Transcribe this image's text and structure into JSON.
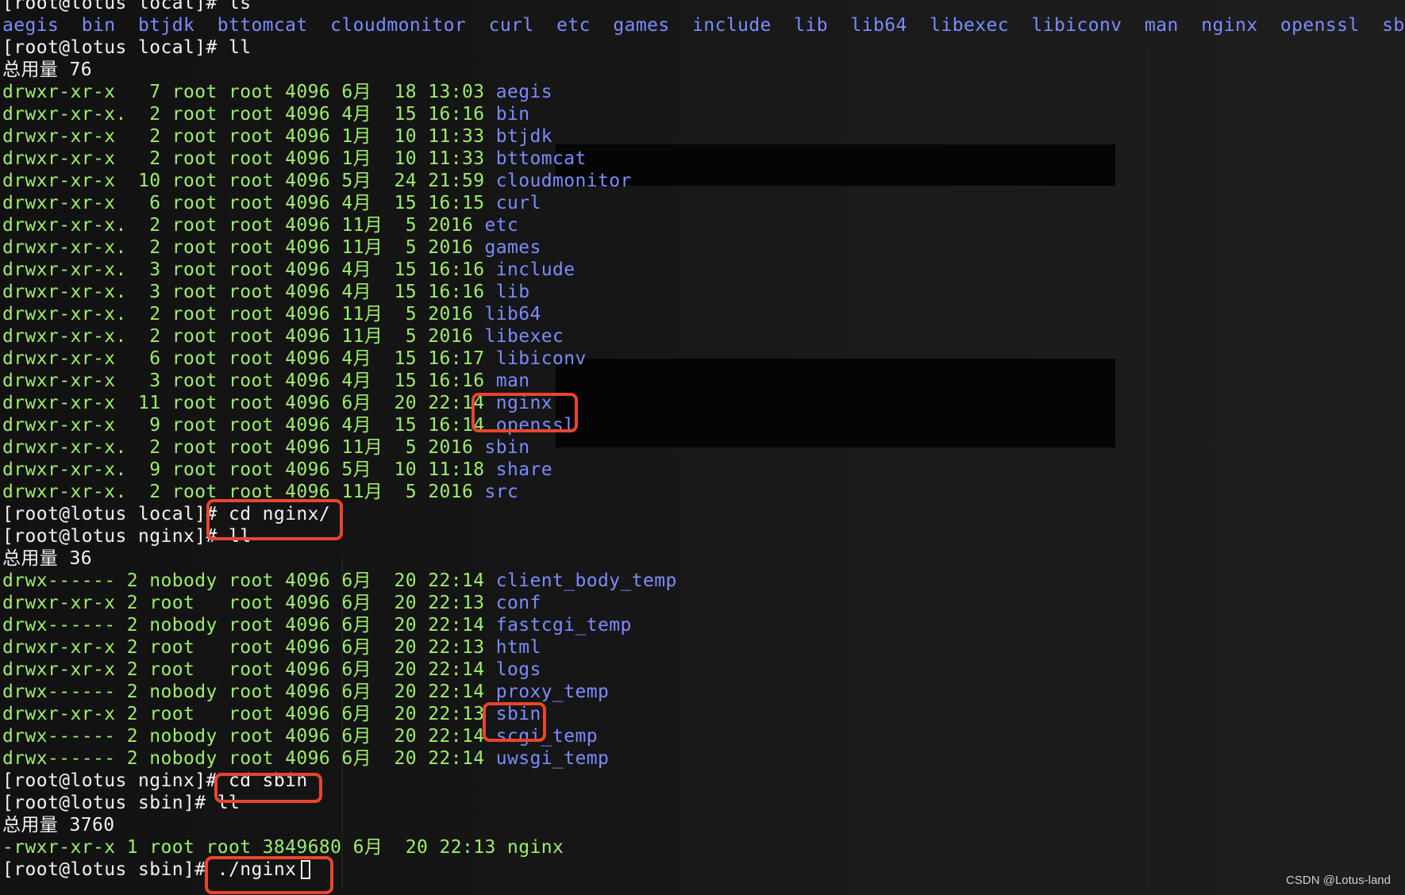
{
  "terminal": {
    "colors": {
      "prompt": "#f2f2f2",
      "listing": "#9dee6c",
      "directory": "#7c8cff",
      "highlight": "#e8452e",
      "background": "#141414"
    },
    "lines": [
      [
        {
          "t": "[root@lotus local]# ls",
          "c": "white"
        }
      ],
      [
        {
          "t": "aegis  bin  btjdk  bttomcat  cloudmonitor  curl  etc  games  include  lib  lib64  libexec  libiconv  man  nginx  openssl  sbin",
          "c": "blue"
        }
      ],
      [
        {
          "t": "[root@lotus local]# ll",
          "c": "white"
        }
      ],
      [
        {
          "t": "总用量 76",
          "c": "white"
        }
      ],
      [
        {
          "t": "drwxr-xr-x   7 root root 4096 6月  18 13:03 ",
          "c": "green"
        },
        {
          "t": "aegis",
          "c": "blue"
        }
      ],
      [
        {
          "t": "drwxr-xr-x.  2 root root 4096 4月  15 16:16 ",
          "c": "green"
        },
        {
          "t": "bin",
          "c": "blue"
        }
      ],
      [
        {
          "t": "drwxr-xr-x   2 root root 4096 1月  10 11:33 ",
          "c": "green"
        },
        {
          "t": "btjdk",
          "c": "blue"
        }
      ],
      [
        {
          "t": "drwxr-xr-x   2 root root 4096 1月  10 11:33 ",
          "c": "green"
        },
        {
          "t": "bttomcat",
          "c": "blue"
        }
      ],
      [
        {
          "t": "drwxr-xr-x  10 root root 4096 5月  24 21:59 ",
          "c": "green"
        },
        {
          "t": "cloudmonitor",
          "c": "blue"
        }
      ],
      [
        {
          "t": "drwxr-xr-x   6 root root 4096 4月  15 16:15 ",
          "c": "green"
        },
        {
          "t": "curl",
          "c": "blue"
        }
      ],
      [
        {
          "t": "drwxr-xr-x.  2 root root 4096 11月  5 2016 ",
          "c": "green"
        },
        {
          "t": "etc",
          "c": "blue"
        }
      ],
      [
        {
          "t": "drwxr-xr-x.  2 root root 4096 11月  5 2016 ",
          "c": "green"
        },
        {
          "t": "games",
          "c": "blue"
        }
      ],
      [
        {
          "t": "drwxr-xr-x.  3 root root 4096 4月  15 16:16 ",
          "c": "green"
        },
        {
          "t": "include",
          "c": "blue"
        }
      ],
      [
        {
          "t": "drwxr-xr-x.  3 root root 4096 4月  15 16:16 ",
          "c": "green"
        },
        {
          "t": "lib",
          "c": "blue"
        }
      ],
      [
        {
          "t": "drwxr-xr-x.  2 root root 4096 11月  5 2016 ",
          "c": "green"
        },
        {
          "t": "lib64",
          "c": "blue"
        }
      ],
      [
        {
          "t": "drwxr-xr-x.  2 root root 4096 11月  5 2016 ",
          "c": "green"
        },
        {
          "t": "libexec",
          "c": "blue"
        }
      ],
      [
        {
          "t": "drwxr-xr-x   6 root root 4096 4月  15 16:17 ",
          "c": "green"
        },
        {
          "t": "libiconv",
          "c": "blue"
        }
      ],
      [
        {
          "t": "drwxr-xr-x   3 root root 4096 4月  15 16:16 ",
          "c": "green"
        },
        {
          "t": "man",
          "c": "blue"
        }
      ],
      [
        {
          "t": "drwxr-xr-x  11 root root 4096 6月  20 22:14 ",
          "c": "green"
        },
        {
          "t": "nginx",
          "c": "blue"
        }
      ],
      [
        {
          "t": "drwxr-xr-x   9 root root 4096 4月  15 16:14 ",
          "c": "green"
        },
        {
          "t": "openssl",
          "c": "blue"
        }
      ],
      [
        {
          "t": "drwxr-xr-x.  2 root root 4096 11月  5 2016 ",
          "c": "green"
        },
        {
          "t": "sbin",
          "c": "blue"
        }
      ],
      [
        {
          "t": "drwxr-xr-x.  9 root root 4096 5月  10 11:18 ",
          "c": "green"
        },
        {
          "t": "share",
          "c": "blue"
        }
      ],
      [
        {
          "t": "drwxr-xr-x.  2 root root 4096 11月  5 2016 ",
          "c": "green"
        },
        {
          "t": "src",
          "c": "blue"
        }
      ],
      [
        {
          "t": "[root@lotus local]# cd nginx/",
          "c": "white"
        }
      ],
      [
        {
          "t": "[root@lotus nginx]# ll",
          "c": "white"
        }
      ],
      [
        {
          "t": "总用量 36",
          "c": "white"
        }
      ],
      [
        {
          "t": "drwx------ 2 nobody root 4096 6月  20 22:14 ",
          "c": "green"
        },
        {
          "t": "client_body_temp",
          "c": "blue"
        }
      ],
      [
        {
          "t": "drwxr-xr-x 2 root   root 4096 6月  20 22:13 ",
          "c": "green"
        },
        {
          "t": "conf",
          "c": "blue"
        }
      ],
      [
        {
          "t": "drwx------ 2 nobody root 4096 6月  20 22:14 ",
          "c": "green"
        },
        {
          "t": "fastcgi_temp",
          "c": "blue"
        }
      ],
      [
        {
          "t": "drwxr-xr-x 2 root   root 4096 6月  20 22:13 ",
          "c": "green"
        },
        {
          "t": "html",
          "c": "blue"
        }
      ],
      [
        {
          "t": "drwxr-xr-x 2 root   root 4096 6月  20 22:14 ",
          "c": "green"
        },
        {
          "t": "logs",
          "c": "blue"
        }
      ],
      [
        {
          "t": "drwx------ 2 nobody root 4096 6月  20 22:14 ",
          "c": "green"
        },
        {
          "t": "proxy_temp",
          "c": "blue"
        }
      ],
      [
        {
          "t": "drwxr-xr-x 2 root   root 4096 6月  20 22:13 ",
          "c": "green"
        },
        {
          "t": "sbin",
          "c": "blue"
        }
      ],
      [
        {
          "t": "drwx------ 2 nobody root 4096 6月  20 22:14 ",
          "c": "green"
        },
        {
          "t": "scgi_temp",
          "c": "blue"
        }
      ],
      [
        {
          "t": "drwx------ 2 nobody root 4096 6月  20 22:14 ",
          "c": "green"
        },
        {
          "t": "uwsgi_temp",
          "c": "blue"
        }
      ],
      [
        {
          "t": "[root@lotus nginx]# cd sbin",
          "c": "white"
        }
      ],
      [
        {
          "t": "[root@lotus sbin]# ll",
          "c": "white"
        }
      ],
      [
        {
          "t": "总用量 3760",
          "c": "white"
        }
      ],
      [
        {
          "t": "-rwxr-xr-x 1 root root 3849680 6月  20 22:13 ",
          "c": "green"
        },
        {
          "t": "nginx",
          "c": "green"
        }
      ],
      [
        {
          "t": "[root@lotus sbin]# ./nginx",
          "c": "white"
        },
        {
          "cursor": true
        }
      ]
    ]
  },
  "watermark": "CSDN @Lotus-land"
}
